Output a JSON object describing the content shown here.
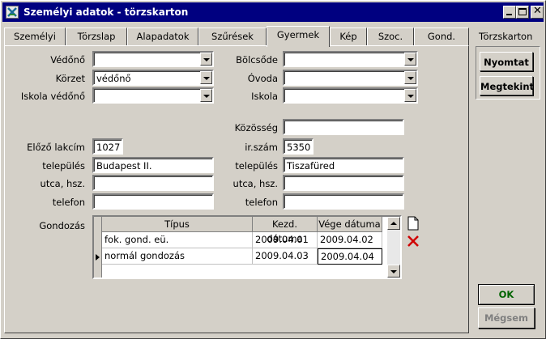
{
  "window": {
    "title": "Személyi adatok - törzskarton"
  },
  "tabs": [
    {
      "label": "Személyi"
    },
    {
      "label": "Törzslap"
    },
    {
      "label": "Alapadatok"
    },
    {
      "label": "Szűrések"
    },
    {
      "label": "Gyermek"
    },
    {
      "label": "Kép"
    },
    {
      "label": "Szoc."
    },
    {
      "label": "Gond."
    }
  ],
  "active_tab": "Gyermek",
  "side": {
    "label": "Törzskarton",
    "print_button": "Nyomtat",
    "view_button": "Megtekint"
  },
  "form": {
    "vedono_label": "Védőnő",
    "vedono_value": "",
    "korzet_label": "Körzet",
    "korzet_value": "védőnő",
    "iskola_vedono_label": "Iskola védőnő",
    "iskola_vedono_value": "",
    "bolcsode_label": "Bölcsőde",
    "bolcsode_value": "",
    "ovoda_label": "Óvoda",
    "ovoda_value": "",
    "iskola_label": "Iskola",
    "iskola_value": "",
    "kozosseg_label": "Közösség",
    "kozosseg_value": "",
    "elozo_lakcim_label": "Előző lakcím",
    "elozo_irszam_value": "1027",
    "irszam_label": "ir.szám",
    "irszam_value": "5350",
    "telepules_label_left": "település",
    "telepules_value_left": "Budapest II.",
    "telepules_label_right": "település",
    "telepules_value_right": "Tiszafüred",
    "utca_label_left": "utca, hsz.",
    "utca_value_left": "",
    "utca_label_right": "utca, hsz.",
    "utca_value_right": "",
    "telefon_label_left": "telefon",
    "telefon_value_left": "",
    "telefon_label_right": "telefon",
    "telefon_value_right": ""
  },
  "gondozas": {
    "label": "Gondozás",
    "columns": [
      "Típus",
      "Kezd. dátuma",
      "Vége dátuma"
    ],
    "rows": [
      {
        "tipus": "fok. gond. eü.",
        "kezd": "2009.04.01",
        "vege": "2009.04.02"
      },
      {
        "tipus": "normál gondozás",
        "kezd": "2009.04.03",
        "vege": "2009.04.04"
      }
    ]
  },
  "actions": {
    "ok": "OK",
    "cancel": "Mégsem"
  }
}
